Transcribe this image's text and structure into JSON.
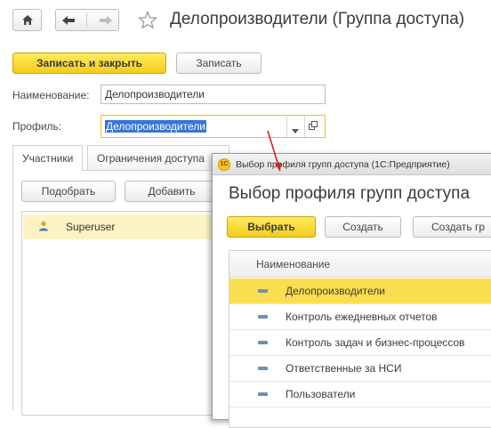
{
  "main": {
    "title": "Делопроизводители (Группа доступа)",
    "toolbar": {
      "save_close_label": "Записать и закрыть",
      "save_label": "Записать"
    },
    "name_label": "Наименование:",
    "name_value": "Делопроизводители",
    "profile_label": "Профиль:",
    "profile_value": "Делопроизводители",
    "tabs": [
      {
        "label": "Участники"
      },
      {
        "label": "Ограничения доступа"
      }
    ],
    "members_toolbar": {
      "pick_label": "Подобрать",
      "add_label": "Добавить"
    },
    "members": [
      {
        "name": "Superuser"
      }
    ]
  },
  "dialog": {
    "window_title": "Выбор профиля групп доступа  (1С:Предприятие)",
    "logo_text": "1С",
    "heading": "Выбор профиля групп доступа",
    "toolbar": {
      "select_label": "Выбрать",
      "create_label": "Создать",
      "create_group_label": "Создать гр"
    },
    "column_header": "Наименование",
    "rows": [
      {
        "name": "Делопроизводители",
        "selected": true
      },
      {
        "name": "Контроль ежедневных отчетов"
      },
      {
        "name": "Контроль задач и бизнес-процессов"
      },
      {
        "name": "Ответственные за НСИ"
      },
      {
        "name": "Пользователи"
      }
    ]
  },
  "colors": {
    "accent_yellow": "#f3cc1a",
    "selection_blue": "#3875d7",
    "arrow_red": "#d62020"
  }
}
